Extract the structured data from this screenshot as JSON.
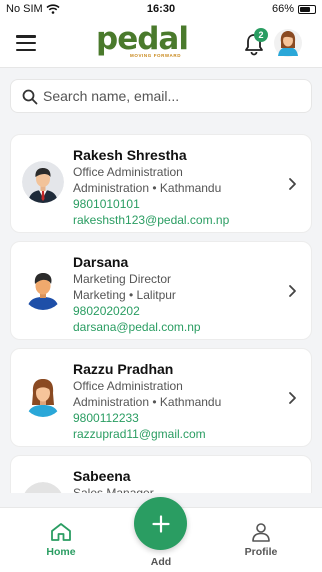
{
  "status_bar": {
    "carrier": "No SIM",
    "time": "16:30",
    "battery": "66%",
    "battery_level": 0.66
  },
  "header": {
    "logo_text": "pedal",
    "logo_tagline": "MOVING FORWARD",
    "notification_count": "2"
  },
  "search": {
    "placeholder": "Search name, email..."
  },
  "contacts": [
    {
      "name": "Rakesh Shrestha",
      "title": "Office Administration",
      "dept_location": "Administration • Kathmandu",
      "phone": "9801010101",
      "email": "rakeshsth123@pedal.com.np",
      "avatar": "male-suit-avatar"
    },
    {
      "name": "Darsana",
      "title": "Marketing Director",
      "dept_location": "Marketing • Lalitpur",
      "phone": "9802020202",
      "email": "darsana@pedal.com.np",
      "avatar": "male-avatar"
    },
    {
      "name": "Razzu Pradhan",
      "title": "Office Administration",
      "dept_location": "Administration • Kathmandu",
      "phone": "9800112233",
      "email": "razzuprad11@gmail.com",
      "avatar": "female-avatar"
    },
    {
      "name": "Sabeena",
      "title": "Sales Manager",
      "dept_location": "",
      "phone": "",
      "email": "",
      "avatar": "placeholder-avatar"
    }
  ],
  "bottom_nav": {
    "home": "Home",
    "add": "Add",
    "profile": "Profile"
  },
  "colors": {
    "accent": "#2a9d62",
    "logo_green": "#4a7a2c",
    "logo_orange": "#c8871a"
  }
}
